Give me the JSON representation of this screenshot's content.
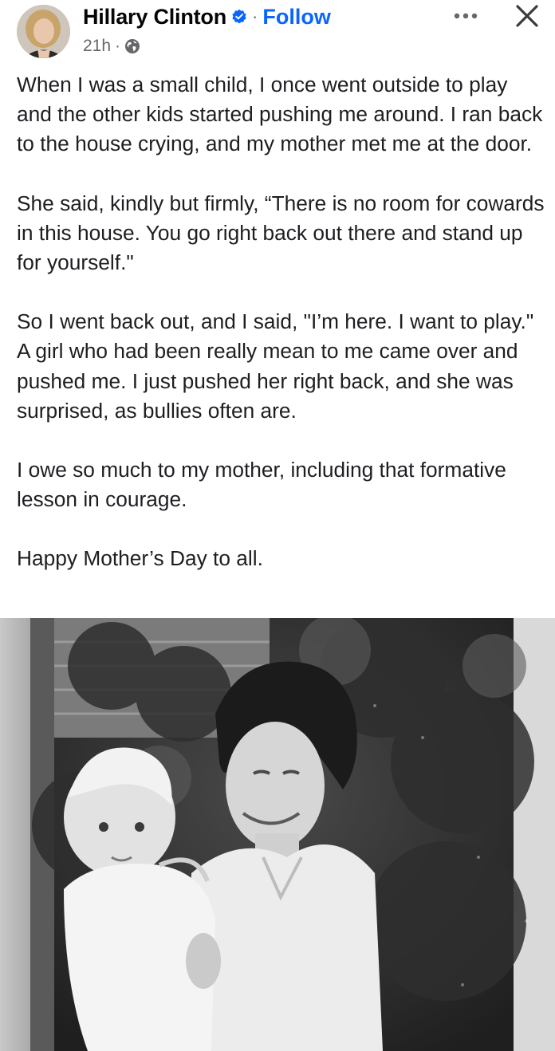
{
  "post": {
    "author_name": "Hillary Clinton",
    "follow_label": "Follow",
    "separator": "·",
    "timestamp": "21h",
    "privacy_icon": "globe-icon",
    "verified_icon": "verified-badge-icon",
    "more_icon": "more-options-icon",
    "close_icon": "close-icon",
    "accent_color": "#0866ff",
    "paragraphs": [
      "When I was a small child, I once went outside to play and the other kids started pushing me around.  I ran back to the house crying, and my mother met me at the door.",
      "She said, kindly but firmly, “There is no room for cowards in this house. You go right back out there and stand up for yourself.\"",
      "So I went back out, and I said, \"I’m here. I want to play.\" A girl who had been really mean to me came over and pushed me. I just pushed her right back, and she was surprised, as bullies often are.",
      "I owe so much to my mother, including that formative lesson in courage.",
      "Happy Mother’s Day to all."
    ]
  }
}
